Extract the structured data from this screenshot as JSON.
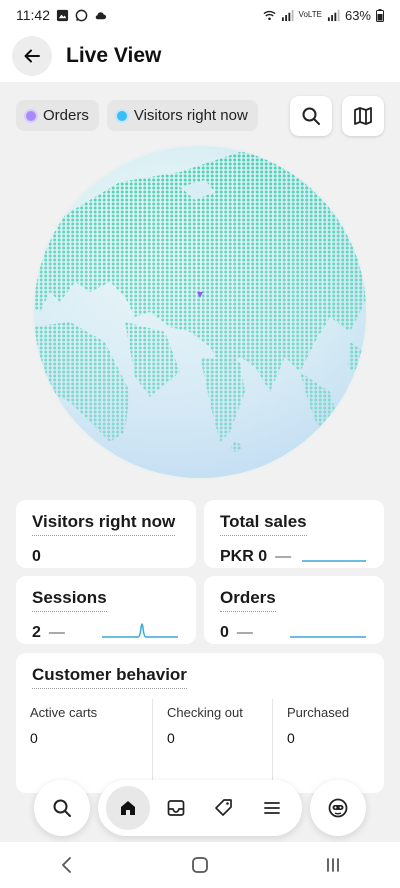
{
  "status_bar": {
    "time": "11:42",
    "network": "VoLTE",
    "battery": "63%"
  },
  "header": {
    "title": "Live View"
  },
  "legend": {
    "orders": {
      "label": "Orders",
      "color": "#a78bfa"
    },
    "visitors": {
      "label": "Visitors right now",
      "color": "#38bdf8"
    }
  },
  "metrics": {
    "visitors_now": {
      "title": "Visitors right now",
      "value": "0"
    },
    "total_sales": {
      "title": "Total sales",
      "value": "PKR 0",
      "dash": "—"
    },
    "sessions": {
      "title": "Sessions",
      "value": "2",
      "dash": "—"
    },
    "orders": {
      "title": "Orders",
      "value": "0",
      "dash": "—"
    }
  },
  "behavior": {
    "title": "Customer behavior",
    "columns": [
      {
        "label": "Active carts",
        "value": "0"
      },
      {
        "label": "Checking out",
        "value": "0"
      },
      {
        "label": "Purchased",
        "value": "0"
      }
    ]
  },
  "nav": {
    "items": [
      "search-icon",
      "home-icon",
      "inbox-icon",
      "tag-icon",
      "menu-icon",
      "assistant-icon"
    ]
  },
  "colors": {
    "accent": "#3aa9d6",
    "globe_land": "#4fd6b8",
    "globe_sea": "#d6edf3"
  }
}
